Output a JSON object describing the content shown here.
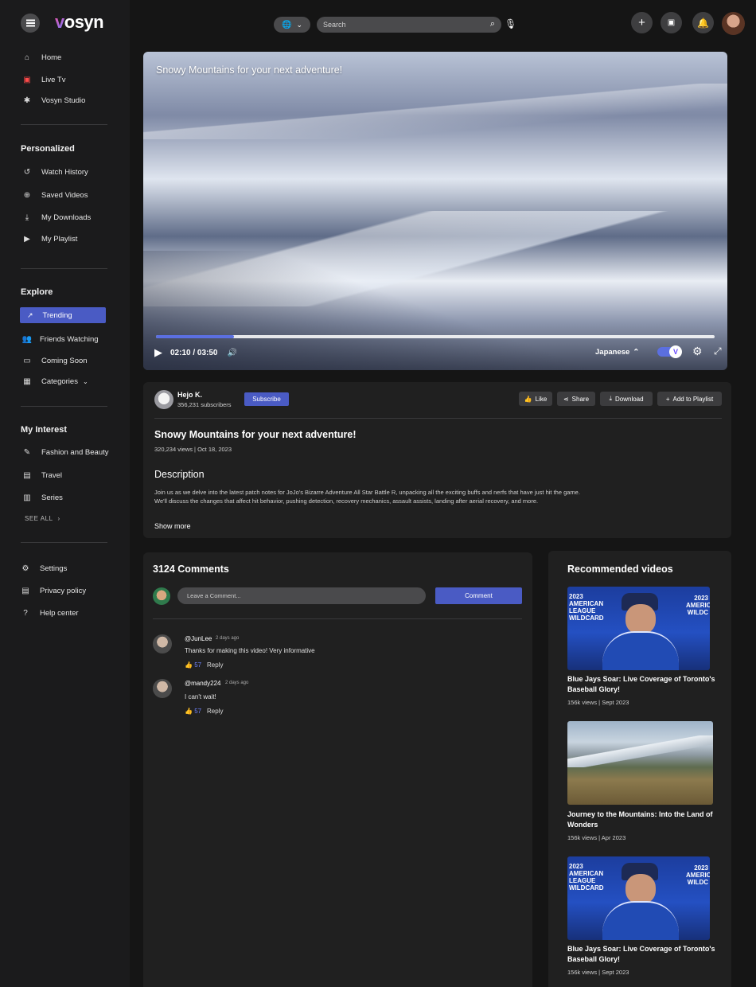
{
  "app": {
    "name_prefix": "v",
    "name_rest": "osyn"
  },
  "nav": {
    "main": [
      {
        "label": "Home",
        "icon": "home-icon"
      },
      {
        "label": "Live Tv",
        "icon": "tv-icon"
      },
      {
        "label": "Vosyn Studio",
        "icon": "studio-icon"
      }
    ],
    "personalized_title": "Personalized",
    "personalized": [
      {
        "label": "Watch History",
        "icon": "history-icon"
      },
      {
        "label": "Saved Videos",
        "icon": "add-circle-icon"
      },
      {
        "label": "My Downloads",
        "icon": "download-icon"
      },
      {
        "label": "My Playlist",
        "icon": "playlist-icon"
      }
    ],
    "explore_title": "Explore",
    "explore": [
      {
        "label": "Trending",
        "icon": "trending-icon",
        "active": true
      },
      {
        "label": "Friends Watching",
        "icon": "friends-icon"
      },
      {
        "label": "Coming Soon",
        "icon": "coming-soon-icon"
      },
      {
        "label": "Categories",
        "icon": "grid-icon"
      }
    ],
    "interest_title": "My Interest",
    "interest": [
      {
        "label": "Fashion and Beauty",
        "icon": "brush-icon"
      },
      {
        "label": "Travel",
        "icon": "suitcase-icon"
      },
      {
        "label": "Series",
        "icon": "series-icon"
      }
    ],
    "see_all": "SEE ALL",
    "footer": [
      {
        "label": "Settings",
        "icon": "gear-icon"
      },
      {
        "label": "Privacy policy",
        "icon": "document-icon"
      },
      {
        "label": "Help center",
        "icon": "help-icon"
      }
    ]
  },
  "topbar": {
    "search_placeholder": "Search"
  },
  "player": {
    "title": "Snowy Mountains for your next adventure!",
    "time": "02:10 / 03:50",
    "progress": 0.14,
    "language": "Japanese",
    "accent": "#5b6fe0"
  },
  "channel": {
    "name": "Hejo K.",
    "subscribers": "356,231 subscribers",
    "subscribe_label": "Subscribe"
  },
  "actions": {
    "like": "Like",
    "share": "Share",
    "download": "Download",
    "playlist": "Add to Playlist"
  },
  "video": {
    "title": "Snowy Mountains for your next adventure!",
    "meta": "320,234 views | Oct 18, 2023",
    "description_title": "Description",
    "description": "Join us as we delve into the latest patch notes for JoJo's Bizarre Adventure All Star Battle R, unpacking all the exciting buffs and nerfs that have just hit the game. We'll discuss the changes that affect hit behavior, pushing detection, recovery mechanics, assault assists, landing after aerial recovery, and more.",
    "show_more": "Show more"
  },
  "comments": {
    "heading": "3124 Comments",
    "input_placeholder": "Leave a Comment...",
    "button": "Comment",
    "items": [
      {
        "user": "@JunLee",
        "ago": "2 days ago",
        "text": "Thanks for making this video! Very informative",
        "likes": "57",
        "reply": "Reply"
      },
      {
        "user": "@mandy224",
        "ago": "2 days ago",
        "text": "I can't wait!",
        "likes": "57",
        "reply": "Reply"
      }
    ]
  },
  "recommended": {
    "heading": "Recommended videos",
    "items": [
      {
        "title": "Blue Jays Soar: Live Coverage of Toronto's Baseball Glory!",
        "meta": "156k views | Sept 2023",
        "thumb_left": "2023 AMERICAN LEAGUE WILDCARD",
        "thumb_right": "2023 AMERICAN WILDC"
      },
      {
        "title": "Journey to the Mountains: Into the Land of Wonders",
        "meta": "156k views | Apr 2023"
      },
      {
        "title": "Blue Jays Soar: Live Coverage of Toronto's Baseball Glory!",
        "meta": "156k views | Sept 2023",
        "thumb_left": "2023 AMERICAN LEAGUE WILDCARD",
        "thumb_right": "2023 AMERICAN WILDC"
      }
    ]
  },
  "colors": {
    "brand": "#4a5bc4",
    "background": "#151515",
    "panel": "#202020"
  }
}
